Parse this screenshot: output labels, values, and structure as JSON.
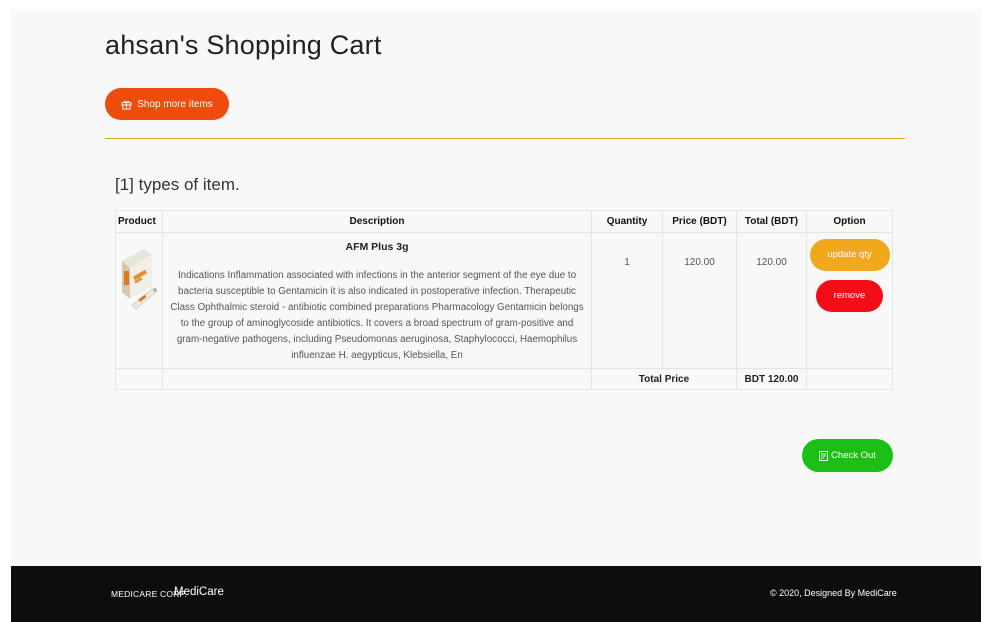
{
  "header": {
    "title": "ahsan's Shopping Cart",
    "shop_more_label": "Shop more items"
  },
  "cart": {
    "types_line": "[1] types of item.",
    "columns": {
      "product": "Product",
      "description": "Description",
      "quantity": "Quantity",
      "price": "Price (BDT)",
      "total": "Total (BDT)",
      "option": "Option"
    },
    "items": [
      {
        "name": "AFM Plus 3g",
        "description": "Indications Inflammation associated with infections in the anterior segment of the eye due to bacteria susceptible to Gentamicin it is also indicated in postoperative infection. Therapeutic Class Ophthalmic steroid - antibiotic combined preparations Pharmacology Gentamicin belongs to the group of aminoglycoside antibiotics. It covers a broad spectrum of gram-positive and gram-negative pathogens, including Pseudomonas aeruginosa, Staphylococci, Haemophilus influenzae H. aegypticus, Klebsiella, En",
        "quantity": "1",
        "price": "120.00",
        "total": "120.00",
        "update_label": "update qty",
        "remove_label": "remove"
      }
    ],
    "total_label": "Total Price",
    "total_value": "BDT 120.00",
    "checkout_label": "Check Out"
  },
  "footer": {
    "brand": "MEDICARE CORP.",
    "name": "MediCare",
    "copyright": "© 2020, Designed By MediCare"
  },
  "colors": {
    "shop_button": "#ef4b0d",
    "divider": "#e0a91b",
    "update_button": "#f2a81d",
    "remove_button": "#f20d17",
    "checkout_button": "#1cbf14",
    "footer_bg": "#0d0d0d"
  },
  "icons": {
    "shop_more": "gift-icon",
    "checkout": "receipt-icon"
  }
}
